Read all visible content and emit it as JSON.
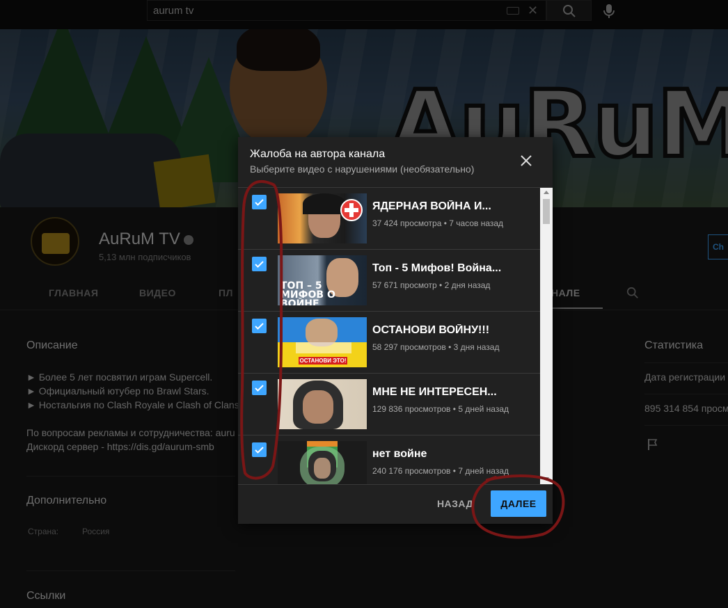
{
  "search": {
    "value": "aurum tv"
  },
  "channel": {
    "name": "AuRuM TV",
    "subscribers": "5,13 млн подписчиков",
    "banner_text": "AuRuM",
    "tabs": [
      "ГЛАВНАЯ",
      "ВИДЕО",
      "ПЛ",
      "НАЛЕ"
    ],
    "subscribe_partial": "Сh"
  },
  "about": {
    "description_header": "Описание",
    "description": "► Более 5 лет посвятил играм Supercell.\n► Официальный ютубер по Brawl Stars.\n► Ностальгия по Clash Royale и Clash of Clans.\n\nПо вопросам рекламы и сотрудничества: auru\nДискорд сервер - https://dis.gd/aurum-smb",
    "additional_header": "Дополнительно",
    "country_label": "Страна:",
    "country_value": "Россия",
    "links_header": "Ссылки",
    "stats_header": "Статистика",
    "registration": "Дата регистрации",
    "views": "895 314 854 просм"
  },
  "dialog": {
    "title": "Жалоба на автора канала",
    "subtitle": "Выберите видео с нарушениями (необязательно)",
    "back_label": "НАЗАД",
    "next_label": "ДАЛЕЕ",
    "videos": [
      {
        "title": "ЯДЕРНАЯ ВОЙНА И...",
        "views": "37 424 просмотра",
        "age": "7 часов назад",
        "checked": true
      },
      {
        "title": "Топ - 5 Мифов! Война...",
        "views": "57 671 просмотр",
        "age": "2 дня назад",
        "checked": true,
        "thumb_text": "ТОП – 5 МИФОВ О ВОЙНЕ"
      },
      {
        "title": "ОСТАНОВИ ВОЙНУ!!!",
        "views": "58 297 просмотров",
        "age": "3 дня назад",
        "checked": true,
        "thumb_text": "ОСТАНОВИ ЭТО!"
      },
      {
        "title": "МНЕ НЕ ИНТЕРЕСЕН...",
        "views": "129 836 просмотров",
        "age": "5 дней назад",
        "checked": true
      },
      {
        "title": "нет войне",
        "views": "240 176 просмотров",
        "age": "7 дней назад",
        "checked": true
      }
    ]
  },
  "colors": {
    "accent": "#3ea6ff",
    "dialog_bg": "#212121",
    "annotation": "#7a1616"
  }
}
